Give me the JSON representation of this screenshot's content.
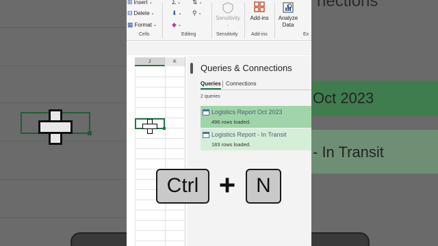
{
  "ribbon": {
    "cells": {
      "insert": "Insert",
      "delete": "Delete",
      "format": "Format",
      "label": "Cells"
    },
    "editing": {
      "label": "Editing"
    },
    "sensitivity": {
      "button": "Sensitivity",
      "label": "Sensitivity"
    },
    "addins": {
      "button": "Add-ins",
      "label": "Add-ins"
    },
    "analyze": {
      "line1": "Analyze",
      "line2": "Data",
      "label_partial": "Ex"
    }
  },
  "sheet": {
    "columns": [
      "J",
      "K"
    ]
  },
  "queries_pane": {
    "title": "Queries & Connections",
    "tabs": [
      "Queries",
      "Connections"
    ],
    "count": "2 queries",
    "items": [
      {
        "name": "Logistics Report Oct 2023",
        "rows": "496 rows loaded."
      },
      {
        "name": "Logistics Report - In Transit",
        "rows": "183 rows loaded."
      }
    ]
  },
  "background_right": {
    "heading_fragment": "nections",
    "item1_fragment": "Oct 2023",
    "item2_fragment": "- In Transit"
  },
  "shortcut": {
    "key1": "Ctrl",
    "plus": "+",
    "key2": "N"
  },
  "colors": {
    "excel_green": "#217346",
    "selected_query": "#9fd5a8",
    "query_bg": "#d5eed8"
  }
}
